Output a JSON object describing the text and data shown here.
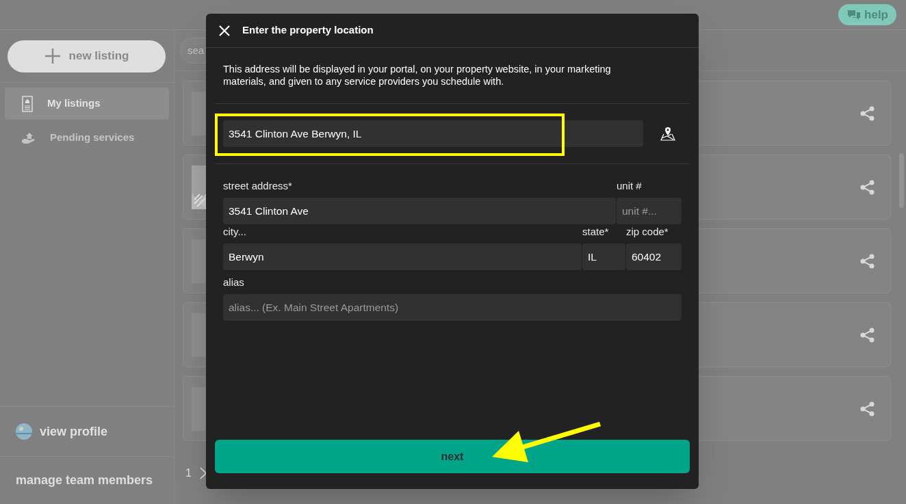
{
  "app": {
    "help_button": "help"
  },
  "sidebar": {
    "new_listing": "new listing",
    "items": [
      {
        "label": "My listings",
        "selected": true,
        "kind": "listings"
      },
      {
        "label": "Pending services",
        "selected": false,
        "kind": "services"
      }
    ],
    "view_profile": "view profile",
    "manage_team": "manage team members"
  },
  "search": {
    "placeholder": "sea"
  },
  "listings": [
    {
      "kind": "blank"
    },
    {
      "kind": "picture"
    },
    {
      "kind": "blank"
    },
    {
      "kind": "blank"
    },
    {
      "kind": "blank"
    }
  ],
  "pagination": {
    "page": "1"
  },
  "modal": {
    "title": "Enter the property location",
    "description": "This address will be displayed in your portal, on your property website, in your marketing materials, and given to any service providers you schedule with.",
    "address_search": {
      "value": "3541 Clinton Ave Berwyn, IL"
    },
    "rows": [
      {
        "fields": [
          {
            "label": "street address*",
            "value": "3541 Clinton Ave"
          },
          {
            "label": "unit #",
            "placeholder": "unit #..."
          }
        ]
      },
      {
        "fields": [
          {
            "label": "city...",
            "value": "Berwyn"
          },
          {
            "label": "state*",
            "value": "IL"
          },
          {
            "label": "zip code*",
            "value": "60402"
          }
        ]
      },
      {
        "fields": [
          {
            "label": "alias",
            "placeholder": "alias... (Ex. Main Street Apartments)"
          }
        ]
      }
    ],
    "next_button": "next"
  }
}
